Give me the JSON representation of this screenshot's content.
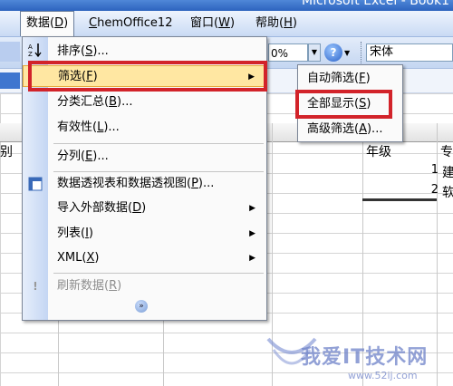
{
  "window": {
    "title": "Microsoft Excel - Book1"
  },
  "menubar": {
    "items": [
      {
        "label": "数据(D)",
        "text": "数据(",
        "key": "D",
        "close": ")"
      },
      {
        "label": "ChemOffice12",
        "text": "",
        "key": "C",
        "close": "hemOffice12"
      },
      {
        "label": "窗口(W)",
        "text": "窗口(",
        "key": "W",
        "close": ")"
      },
      {
        "label": "帮助(H)",
        "text": "帮助(",
        "key": "H",
        "close": ")"
      }
    ]
  },
  "toolbar": {
    "zoom": "0%",
    "help_icon": "?",
    "font_name": "宋体"
  },
  "data_menu": {
    "items": [
      {
        "id": "sort",
        "label": "排序(S)...",
        "text": "排序(",
        "key": "S",
        "close": ")...",
        "icon": "sort-az-icon"
      },
      {
        "id": "filter",
        "label": "筛选(F)",
        "text": "筛选(",
        "key": "F",
        "close": ")",
        "submenu": true,
        "highlighted": true
      },
      {
        "id": "subtotals",
        "label": "分类汇总(B)...",
        "text": "分类汇总(",
        "key": "B",
        "close": ")..."
      },
      {
        "id": "validation",
        "label": "有效性(L)...",
        "text": "有效性(",
        "key": "L",
        "close": ")..."
      },
      {
        "id": "text-to-columns",
        "label": "分列(E)...",
        "text": "分列(",
        "key": "E",
        "close": ")..."
      },
      {
        "id": "pivot",
        "label": "数据透视表和数据透视图(P)...",
        "text": "数据透视表和数据透视图(",
        "key": "P",
        "close": ")...",
        "icon": "pivot-table-icon"
      },
      {
        "id": "import",
        "label": "导入外部数据(D)",
        "text": "导入外部数据(",
        "key": "D",
        "close": ")",
        "submenu": true
      },
      {
        "id": "list",
        "label": "列表(I)",
        "text": "列表(",
        "key": "I",
        "close": ")",
        "submenu": true
      },
      {
        "id": "xml",
        "label": "XML(X)",
        "text": "XML(",
        "key": "X",
        "close": ")",
        "submenu": true
      },
      {
        "id": "refresh",
        "label": "刷新数据(R)",
        "text": "刷新数据(",
        "key": "R",
        "close": ")",
        "disabled": true,
        "icon": "refresh-icon"
      }
    ],
    "expand_glyph": "»"
  },
  "filter_submenu": {
    "items": [
      {
        "id": "autofilter",
        "label": "自动筛选(F)",
        "text": "自动筛选(",
        "key": "F",
        "close": ")"
      },
      {
        "id": "show-all",
        "label": "全部显示(S)",
        "text": "全部显示(",
        "key": "S",
        "close": ")",
        "highlighted": true
      },
      {
        "id": "advanced",
        "label": "高级筛选(A)...",
        "text": "高级筛选(",
        "key": "A",
        "close": ")..."
      }
    ]
  },
  "sheet": {
    "left_cell_text": "别",
    "header_grade": "年级",
    "header_partial": "专",
    "rows": [
      {
        "num": "1",
        "text": "建"
      },
      {
        "num": "2",
        "text": "软"
      }
    ]
  },
  "watermark": {
    "text": "我爱IT技术网",
    "url": "www.52ij.com"
  },
  "colors": {
    "highlight_red": "#d2232a",
    "menu_hover": "#ffe7a2"
  }
}
